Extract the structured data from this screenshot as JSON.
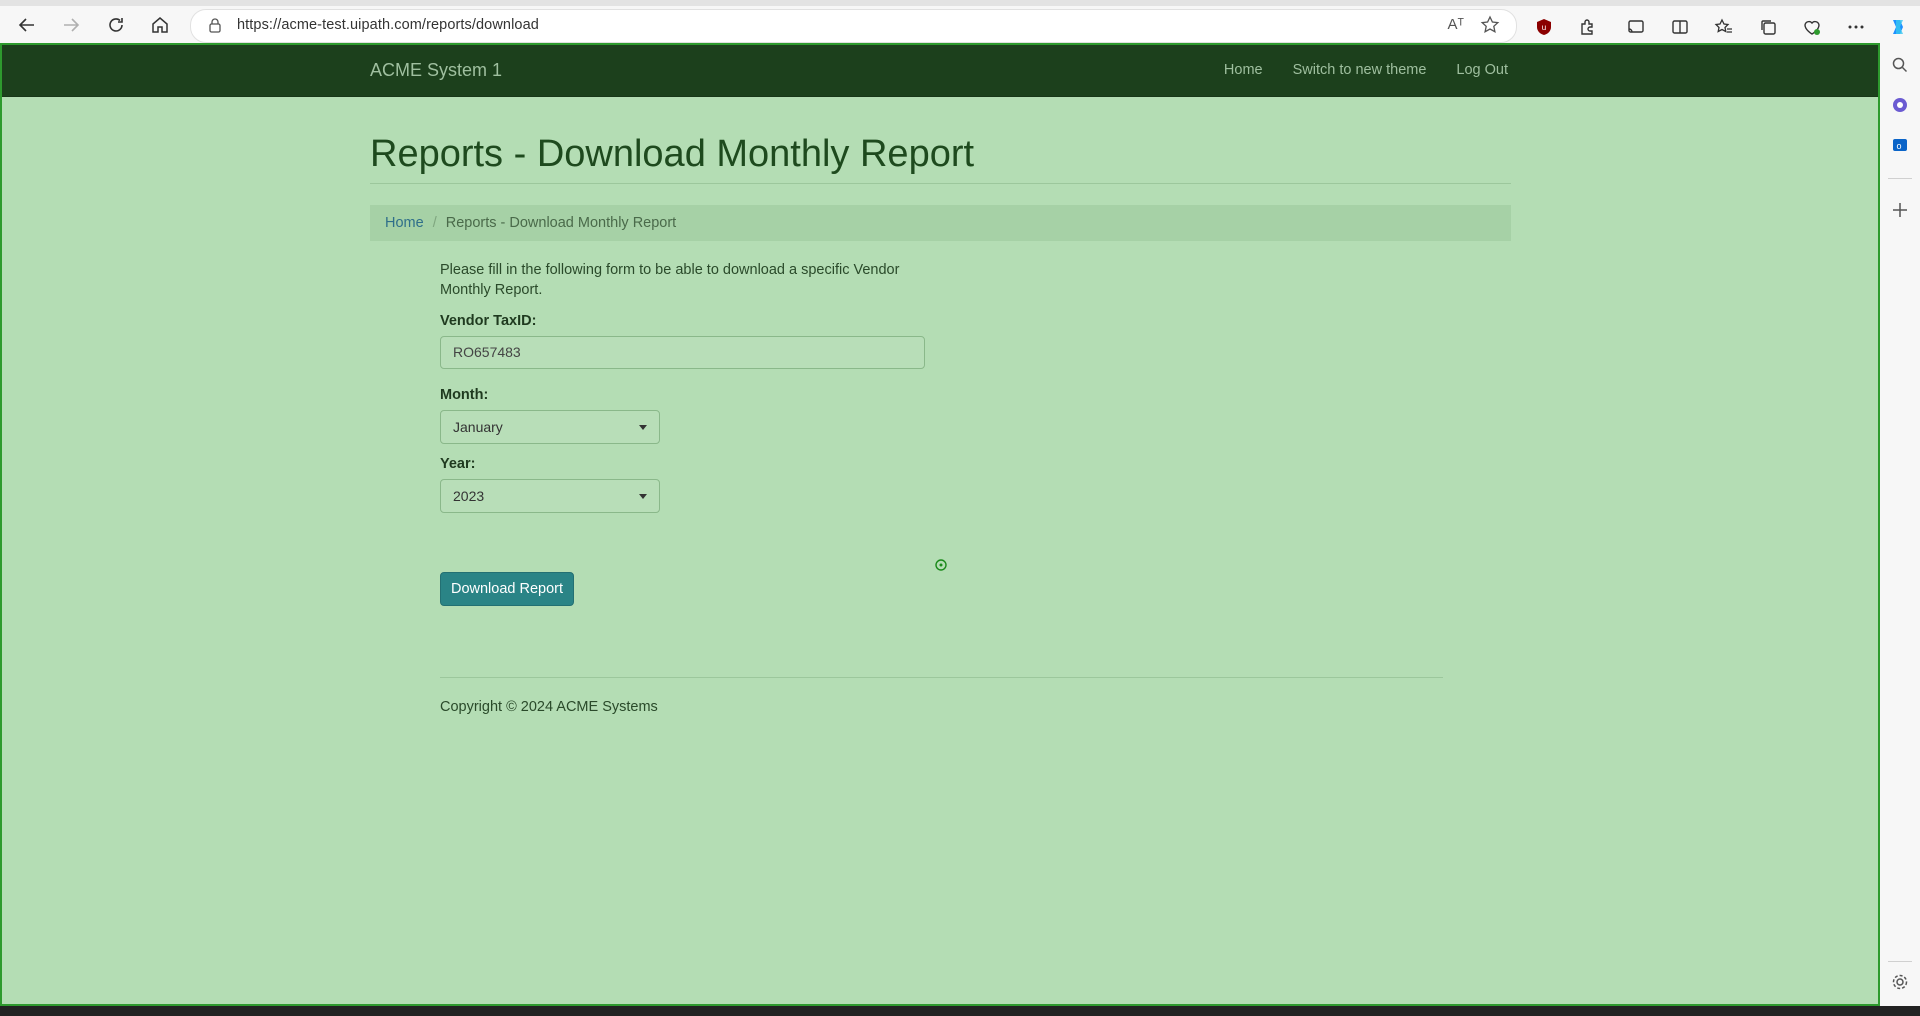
{
  "browser": {
    "url": "https://acme-test.uipath.com/reports/download",
    "read_aloud": "Aᵀ"
  },
  "navbar": {
    "brand": "ACME System 1",
    "links": [
      "Home",
      "Switch to new theme",
      "Log Out"
    ]
  },
  "page": {
    "title": "Reports - Download Monthly Report",
    "breadcrumb": {
      "home": "Home",
      "separator": "/",
      "current": "Reports - Download Monthly Report"
    },
    "intro": "Please fill in the following form to be able to download a specific Vendor Monthly Report.",
    "form": {
      "taxid_label": "Vendor TaxID:",
      "taxid_value": "RO657483",
      "month_label": "Month:",
      "month_value": "January",
      "year_label": "Year:",
      "year_value": "2023",
      "submit_label": "Download Report"
    },
    "footer": "Copyright © 2024 ACME Systems"
  },
  "colors": {
    "page_bg": "#b4ddb4",
    "navbar_bg": "#1c401c",
    "button_bg": "#2a8486",
    "viewport_border": "#2e9a2e"
  }
}
